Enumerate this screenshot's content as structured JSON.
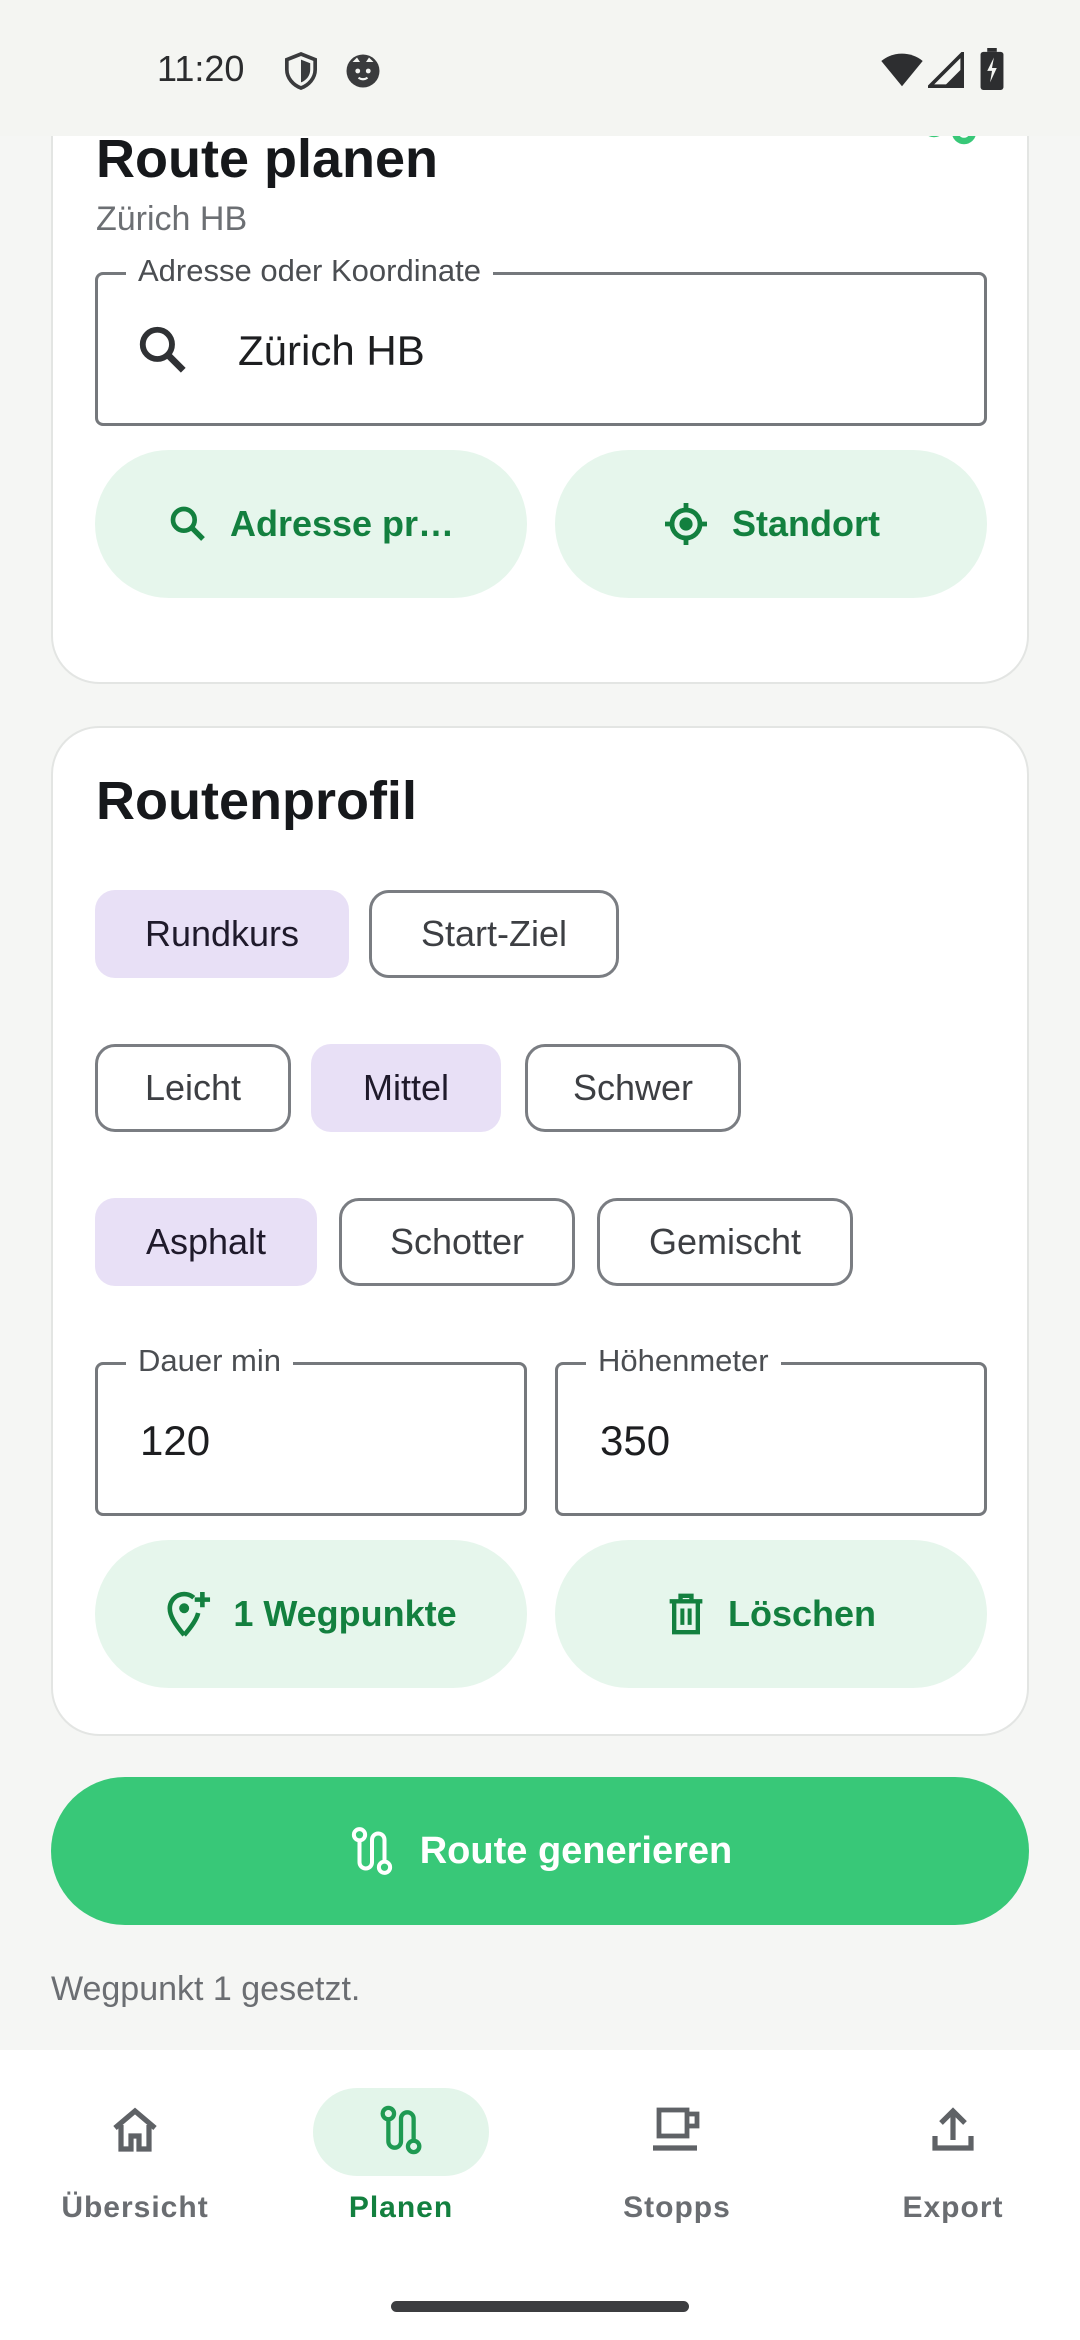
{
  "status_bar": {
    "time": "11:20",
    "icons": [
      "shield-icon",
      "cat-face-icon",
      "wifi-icon",
      "signal-icon",
      "battery-charging-icon"
    ]
  },
  "location_card": {
    "title": "Route planen",
    "subtitle": "Zürich HB",
    "icon": "route-icon",
    "address_field": {
      "label": "Adresse oder Koordinate",
      "value": "Zürich HB",
      "icon": "search-icon"
    },
    "check_address_button": "Adresse pr…",
    "location_button": "Standort"
  },
  "profile_card": {
    "title": "Routenprofil",
    "route_type": {
      "options": [
        "Rundkurs",
        "Start-Ziel"
      ],
      "selected": "Rundkurs"
    },
    "difficulty": {
      "options": [
        "Leicht",
        "Mittel",
        "Schwer"
      ],
      "selected": "Mittel"
    },
    "surface": {
      "options": [
        "Asphalt",
        "Schotter",
        "Gemischt"
      ],
      "selected": "Asphalt"
    },
    "duration_field": {
      "label": "Dauer min",
      "value": "120"
    },
    "elevation_field": {
      "label": "Höhenmeter",
      "value": "350"
    },
    "waypoints_button": "1 Wegpunkte",
    "delete_button": "Löschen"
  },
  "generate_button": "Route generieren",
  "status_message": "Wegpunkt 1 gesetzt.",
  "bottom_nav": {
    "items": [
      {
        "label": "Übersicht",
        "icon": "home-icon",
        "active": false
      },
      {
        "label": "Planen",
        "icon": "route-icon",
        "active": true
      },
      {
        "label": "Stopps",
        "icon": "coffee-cup-icon",
        "active": false
      },
      {
        "label": "Export",
        "icon": "upload-icon",
        "active": false
      }
    ]
  },
  "colors": {
    "accent_green": "#38c878",
    "dark_green_text": "#13803f",
    "tonal_green_bg": "#e6f6ec",
    "selected_chip_bg": "#e8e0f6"
  }
}
